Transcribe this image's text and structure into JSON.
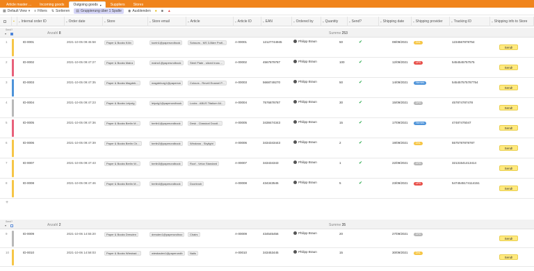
{
  "tabs": [
    {
      "label": "Article master ...",
      "active": false
    },
    {
      "label": "Incoming goods",
      "active": false
    },
    {
      "label": "Outgoing goods",
      "active": true
    },
    {
      "label": "Suppliers",
      "active": false
    },
    {
      "label": "Stores",
      "active": false
    }
  ],
  "toolbar": {
    "default_view": "Default View",
    "filters": "Filters",
    "sort": "Sortieren",
    "grouping": "Gruppierung über 1 Spalte",
    "hide": "Ausblenden"
  },
  "columns": [
    "Internal order ID",
    "Order date",
    "Store",
    "Store email",
    "Article",
    "Article ID",
    "EAN",
    "Ordered by",
    "Quantity",
    "Send?",
    "Shipping date",
    "Shipping provider",
    "Tracking ID",
    "Shipping info to Store"
  ],
  "groups": [
    {
      "label": "Send?",
      "checked": true,
      "count_label": "Anzahl",
      "count": "8",
      "sum_label": "Summe",
      "sum": "253",
      "rows": [
        {
          "num": "1",
          "stripe": "#f6c646",
          "id": "ID-0001",
          "date": "2021-10-05 09:45:58",
          "store": "Paper & Books Köln",
          "email": "koeln1@paperundbook",
          "article": "Scissors - MS 3-Bäre Profi...",
          "article_id": "A-00001",
          "ean": "12127744945",
          "by": "Philipp Braun",
          "qty": "50",
          "send": true,
          "ship": "08/09/2021",
          "provider": "DHL",
          "provider_color": "#f6c646",
          "tracking": "1234567878754",
          "btn": "Send!"
        },
        {
          "num": "2",
          "stripe": "#e8607a",
          "id": "ID-0002",
          "date": "2021-10-05 09:47:27",
          "store": "Paper & Books Mainz",
          "email": "mainz1@paperundbook",
          "article": "Steel Plate - sliced truss ...",
          "article_id": "A-00002",
          "ean": "4567879787",
          "by": "Philipp Braun",
          "qty": "100",
          "send": true,
          "ship": "12/09/2021",
          "provider": "UPS",
          "provider_color": "#e8504a",
          "tracking": "5454545757575",
          "btn": "Send!"
        },
        {
          "num": "3",
          "stripe": "#4d93d9",
          "id": "ID-0003",
          "date": "2021-10-05 09:47:35",
          "store": "Paper & Books Magdeb...",
          "email": "magdeburg1@papersm",
          "article": "Colours - Revell Enamel P...",
          "article_id": "A-00003",
          "ean": "5668749270",
          "by": "Philipp Braun",
          "qty": "50",
          "send": true,
          "ship": "14/09/2021",
          "provider": "Hermes",
          "provider_color": "#4d93d9",
          "tracking": "545457575787754",
          "btn": "Send!"
        },
        {
          "num": "4",
          "stripe": "#b8b8b8",
          "id": "ID-0004",
          "date": "2021-10-05 09:47:23",
          "store": "Paper & Books Leipzig",
          "email": "leipzig1@paperundbook",
          "article": "Locks - ABUS Titalium 64...",
          "article_id": "A-00004",
          "ean": "7576878787",
          "by": "Philipp Braun",
          "qty": "30",
          "send": true,
          "ship": "15/09/2021",
          "provider": "DPD",
          "provider_color": "#b8b8b8",
          "tracking": "457874787478",
          "btn": "Send!"
        },
        {
          "num": "5",
          "stripe": "#e8607a",
          "id": "ID-0005",
          "date": "2021-10-05 09:47:36",
          "store": "Paper & Books Berlin M...",
          "email": "berlin1@paperundbook",
          "article": "Desk - Classical Doodl...",
          "article_id": "A-00005",
          "ean": "3438474343",
          "by": "Philipp Braun",
          "qty": "15",
          "send": true,
          "ship": "17/09/2021",
          "provider": "Hermes",
          "provider_color": "#4d93d9",
          "tracking": "47487475047",
          "btn": "Send!"
        },
        {
          "num": "6",
          "stripe": "#f6c646",
          "id": "ID-0006",
          "date": "2021-10-05 09:47:39",
          "store": "Paper & Books Berlin Ch...",
          "email": "berlin2@paperundbook",
          "article": "Windows - Skylight",
          "article_id": "A-00006",
          "ean": "3434343443",
          "by": "Philipp Braun",
          "qty": "2",
          "send": true,
          "ship": "19/09/2021",
          "provider": "DHL",
          "provider_color": "#f6c646",
          "tracking": "5575787878787",
          "btn": "Send!"
        },
        {
          "num": "7",
          "stripe": "#f6c646",
          "id": "ID-0007",
          "date": "2021-10-05 09:47:43",
          "store": "Paper & Books Berlin W...",
          "email": "berlin3@paperundbook",
          "article": "Roof - Velux Standard",
          "article_id": "A-00007",
          "ean": "343434343",
          "by": "Philipp Braun",
          "qty": "1",
          "send": true,
          "ship": "22/09/2021",
          "provider": "DPD",
          "provider_color": "#b8b8b8",
          "tracking": "32131541413414",
          "btn": "Send!"
        },
        {
          "num": "8",
          "stripe": "#f6c646",
          "id": "ID-0008",
          "date": "2021-10-05 09:47:46",
          "store": "Paper & Books Berlin M...",
          "email": "berlin4@paperundbook",
          "article": "Doorknob",
          "article_id": "A-00008",
          "ean": "434343545",
          "by": "Philipp Braun",
          "qty": "5",
          "send": true,
          "ship": "23/09/2021",
          "provider": "UPS",
          "provider_color": "#e8504a",
          "tracking": "5474545174114151",
          "btn": "Send!"
        }
      ]
    },
    {
      "label": "Send?",
      "checked": false,
      "count_label": "Anzahl",
      "count": "2",
      "sum_label": "Summe",
      "sum": "35",
      "rows": [
        {
          "num": "9",
          "stripe": "#b8b8b8",
          "id": "ID-0009",
          "date": "2021-10-06 14:55:20",
          "store": "Paper & Books Dresden",
          "email": "dresden1@paperundboo",
          "article": "Chairs",
          "article_id": "A-00009",
          "ean": "434545456",
          "by": "Philipp Braun",
          "qty": "20",
          "send": false,
          "ship": "27/09/2021",
          "provider": "DPD",
          "provider_color": "#b8b8b8",
          "tracking": "",
          "btn": "Send!"
        },
        {
          "num": "10",
          "stripe": "#f6c646",
          "id": "ID-0010",
          "date": "2021-10-06 14:58:03",
          "store": "Paper & Books Wiesbad...",
          "email": "wiesbaden1@paperundb",
          "article": "Nails",
          "article_id": "A-00010",
          "ean": "343453445",
          "by": "Philipp Braun",
          "qty": "15",
          "send": false,
          "ship": "30/09/2021",
          "provider": "DHL",
          "provider_color": "#f6c646",
          "tracking": "",
          "btn": "Send!"
        }
      ]
    }
  ]
}
